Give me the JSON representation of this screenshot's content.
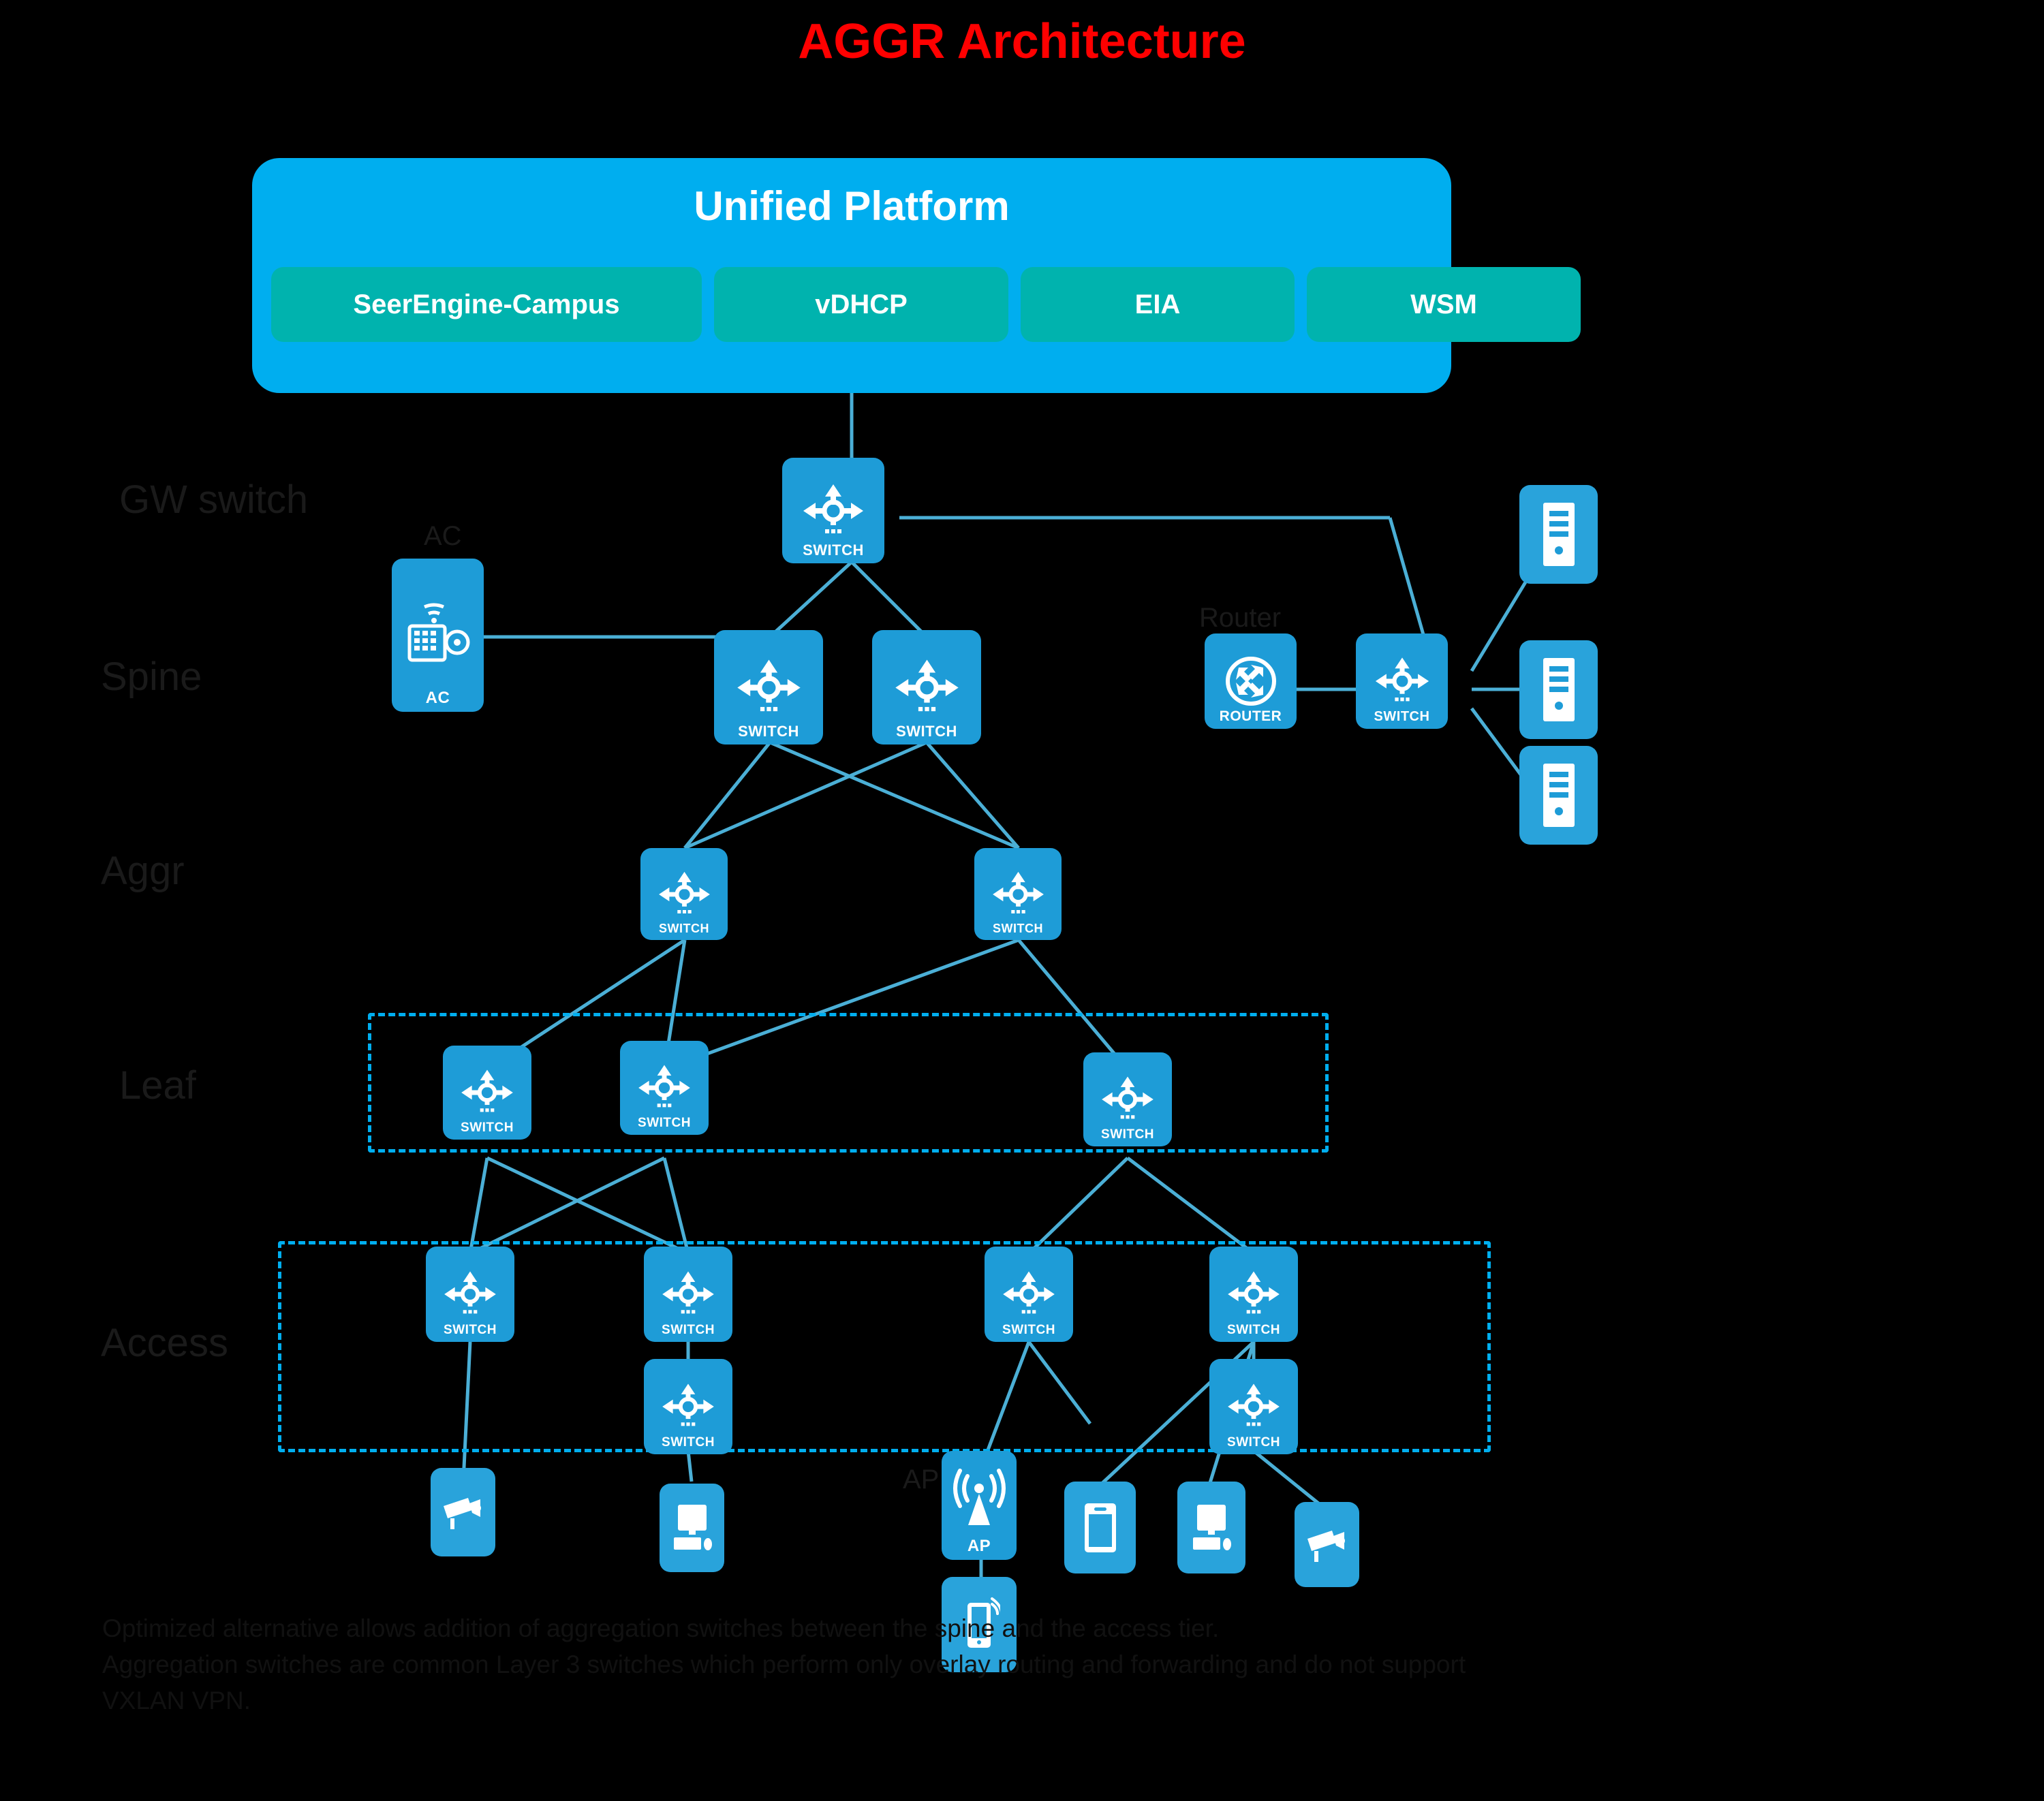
{
  "title": "AGGR Architecture",
  "platform": {
    "name": "Unified Platform",
    "modules": [
      {
        "label": "SeerEngine-Campus"
      },
      {
        "label": "vDHCP"
      },
      {
        "label": "EIA"
      },
      {
        "label": "WSM"
      }
    ]
  },
  "layer_labels": [
    {
      "id": "gw-switch",
      "text": "GW switch"
    },
    {
      "id": "spine",
      "text": "Spine"
    },
    {
      "id": "aggr",
      "text": "Aggr"
    },
    {
      "id": "leaf",
      "text": "Leaf"
    },
    {
      "id": "access",
      "text": "Access"
    }
  ],
  "node_labels": {
    "ac": "AC",
    "router": "Router",
    "ap": "AP",
    "switch": "SWITCH"
  },
  "nodes": [
    {
      "id": "gw-switch",
      "type": "switch",
      "caption": "SWITCH"
    },
    {
      "id": "ac-controller",
      "type": "ac",
      "caption": "AC"
    },
    {
      "id": "spine-1",
      "type": "switch",
      "caption": "SWITCH"
    },
    {
      "id": "spine-2",
      "type": "switch",
      "caption": "SWITCH"
    },
    {
      "id": "border-router",
      "type": "router",
      "caption": "ROUTER"
    },
    {
      "id": "border-switch",
      "type": "switch",
      "caption": "SWITCH"
    },
    {
      "id": "server-1",
      "type": "server",
      "caption": ""
    },
    {
      "id": "server-2",
      "type": "server",
      "caption": ""
    },
    {
      "id": "server-3",
      "type": "server",
      "caption": ""
    },
    {
      "id": "aggr-1",
      "type": "switch",
      "caption": "SWITCH"
    },
    {
      "id": "aggr-2",
      "type": "switch",
      "caption": "SWITCH"
    },
    {
      "id": "leaf-1",
      "type": "switch",
      "caption": "SWITCH"
    },
    {
      "id": "leaf-2",
      "type": "switch",
      "caption": "SWITCH"
    },
    {
      "id": "leaf-3",
      "type": "switch",
      "caption": "SWITCH"
    },
    {
      "id": "access-1",
      "type": "switch",
      "caption": "SWITCH"
    },
    {
      "id": "access-2",
      "type": "switch",
      "caption": "SWITCH"
    },
    {
      "id": "access-3",
      "type": "switch",
      "caption": "SWITCH"
    },
    {
      "id": "access-4",
      "type": "switch",
      "caption": "SWITCH"
    },
    {
      "id": "access-5",
      "type": "switch",
      "caption": "SWITCH"
    },
    {
      "id": "access-6",
      "type": "switch",
      "caption": "SWITCH"
    },
    {
      "id": "camera-left",
      "type": "camera",
      "caption": ""
    },
    {
      "id": "pc-left",
      "type": "pc",
      "caption": ""
    },
    {
      "id": "ap",
      "type": "ap",
      "caption": "AP"
    },
    {
      "id": "phone",
      "type": "phone",
      "caption": ""
    },
    {
      "id": "tablet",
      "type": "tablet",
      "caption": ""
    },
    {
      "id": "pc-right",
      "type": "pc",
      "caption": ""
    },
    {
      "id": "camera-right",
      "type": "camera",
      "caption": ""
    }
  ],
  "footnotes": [
    "Optimized alternative allows addition of aggregation switches between the spine and the access tier.",
    "Aggregation switches are common Layer 3 switches which perform only overlay routing and forwarding and do not support",
    "VXLAN VPN."
  ],
  "colors": {
    "title": "#ff0000",
    "platform": "#00AEEF",
    "module": "#00B3AE",
    "device": "#29A3DB",
    "link": "#4BAFD6",
    "dash": "#00AEEF"
  }
}
